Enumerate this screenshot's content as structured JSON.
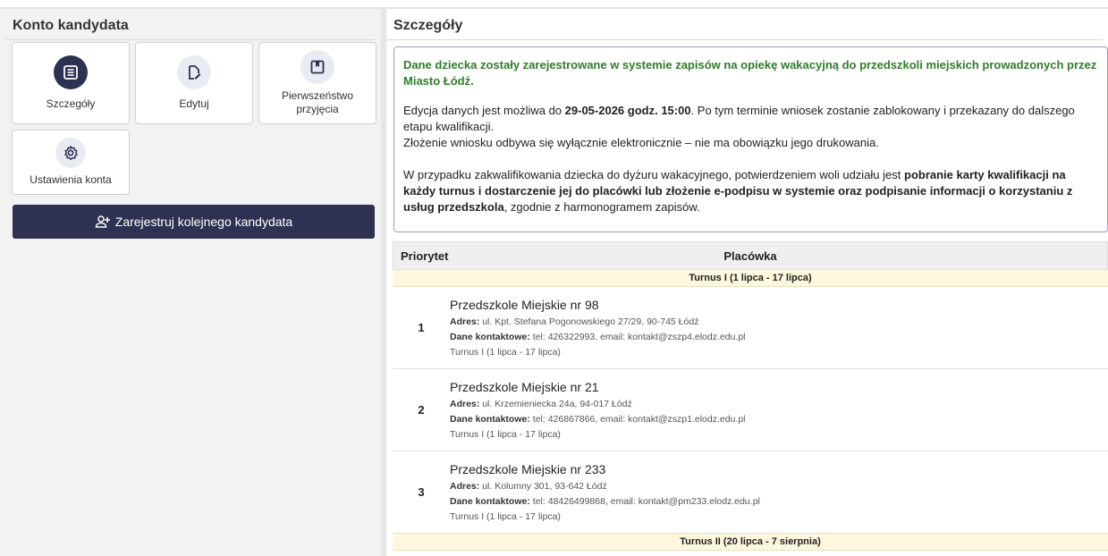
{
  "left": {
    "title": "Konto kandydata",
    "tiles": [
      {
        "label": "Szczegóły",
        "icon": "list-icon",
        "active": true
      },
      {
        "label": "Edytuj",
        "icon": "edit-document-icon"
      },
      {
        "label": "Pierwszeństwo przyjęcia",
        "icon": "bookmark-icon"
      },
      {
        "label": "Ustawienia konta",
        "icon": "gear-icon"
      }
    ],
    "register_label": "Zarejestruj kolejnego kandydata"
  },
  "right": {
    "title": "Szczegóły",
    "info": {
      "green": "Dane dziecka zostały zarejestrowane w systemie zapisów na opiekę wakacyjną do przedszkoli miejskich prowadzonych przez Miasto Łódź.",
      "p1_pre": "Edycja danych jest możliwa do ",
      "p1_bold": "29-05-2026 godz. 15:00",
      "p1_post": ". Po tym terminie wniosek zostanie zablokowany i przekazany do dalszego etapu kwalifikacji.",
      "p2": "Złożenie wniosku odbywa się wyłącznie elektronicznie – nie ma obowiązku jego drukowania.",
      "p3_pre": "W przypadku zakwalifikowania dziecka do dyżuru wakacyjnego, potwierdzeniem woli udziału jest ",
      "p3_bold": "pobranie karty kwalifikacji na każdy turnus i dostarczenie jej do placówki lub złożenie e-podpisu w systemie oraz podpisanie informacji o korzystaniu z usług przedszkola",
      "p3_post": ", zgodnie z harmonogramem zapisów."
    },
    "table": {
      "col_priority": "Priorytet",
      "col_facility": "Placówka",
      "turn1": "Turnus I (1 lipca - 17 lipca)",
      "turn2": "Turnus II (20 lipca - 7 sierpnia)",
      "address_label": "Adres:",
      "contact_label": "Dane kontaktowe:",
      "rows": [
        {
          "priority": "1",
          "name": "Przedszkole Miejskie nr 98",
          "address": "ul. Kpt. Stefana Pogonowskiego 27/29, 90-745 Łódź",
          "contact": "tel: 426322993, email: kontakt@zszp4.elodz.edu.pl",
          "turn": "Turnus I (1 lipca - 17 lipca)"
        },
        {
          "priority": "2",
          "name": "Przedszkole Miejskie nr 21",
          "address": "ul. Krzemieniecka 24a, 94-017 Łódź",
          "contact": "tel: 426867866, email: kontakt@zszp1.elodz.edu.pl",
          "turn": "Turnus I (1 lipca - 17 lipca)"
        },
        {
          "priority": "3",
          "name": "Przedszkole Miejskie nr 233",
          "address": "ul. Kolumny 301, 93-642 Łódź",
          "contact": "tel: 48426499868, email: kontakt@pm233.elodz.edu.pl",
          "turn": "Turnus I (1 lipca - 17 lipca)"
        }
      ]
    }
  },
  "colors": {
    "accent": "#2e3152",
    "green": "#2f7d2a",
    "turn_bg": "#fdf8dd"
  }
}
